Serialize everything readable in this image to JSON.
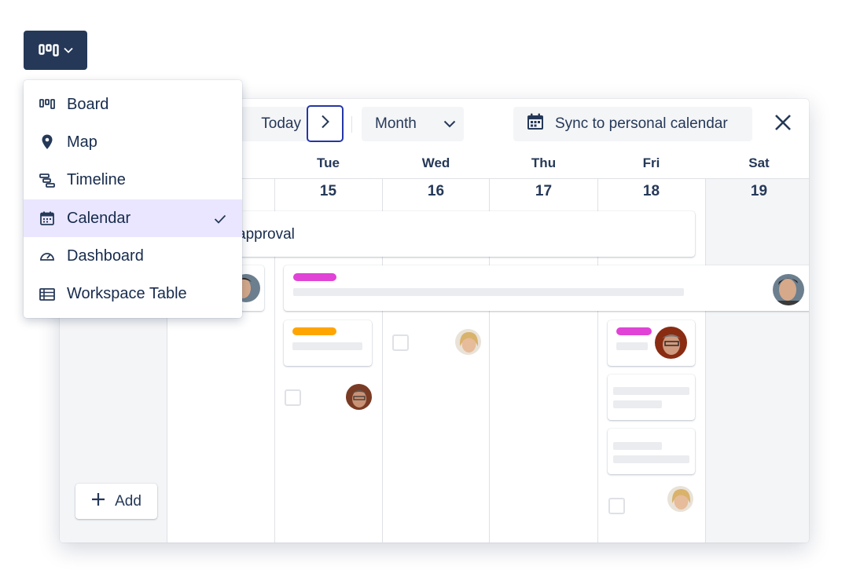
{
  "toolbar": {
    "today_label": "Today",
    "month_label": "Month",
    "sync_label": "Sync to personal calendar"
  },
  "day_headers": [
    "Tue",
    "Wed",
    "Thu",
    "Fri",
    "Sat"
  ],
  "dates": [
    "15",
    "16",
    "17",
    "18",
    "19"
  ],
  "event": {
    "title_fragment": "approval"
  },
  "add_button": {
    "label": "Add"
  },
  "view_menu": {
    "items": [
      {
        "label": "Board",
        "icon": "board-icon",
        "selected": false
      },
      {
        "label": "Map",
        "icon": "map-pin-icon",
        "selected": false
      },
      {
        "label": "Timeline",
        "icon": "timeline-icon",
        "selected": false
      },
      {
        "label": "Calendar",
        "icon": "calendar-icon",
        "selected": true
      },
      {
        "label": "Dashboard",
        "icon": "dashboard-icon",
        "selected": false
      },
      {
        "label": "Workspace Table",
        "icon": "table-icon",
        "selected": false
      }
    ]
  },
  "colors": {
    "primary_dark": "#253858",
    "selected_bg": "#eae6ff",
    "focus_border": "#2436a6",
    "tag_magenta": "#e043d6",
    "tag_orange": "#ffa500",
    "weekend_bg": "#f4f5f7"
  }
}
